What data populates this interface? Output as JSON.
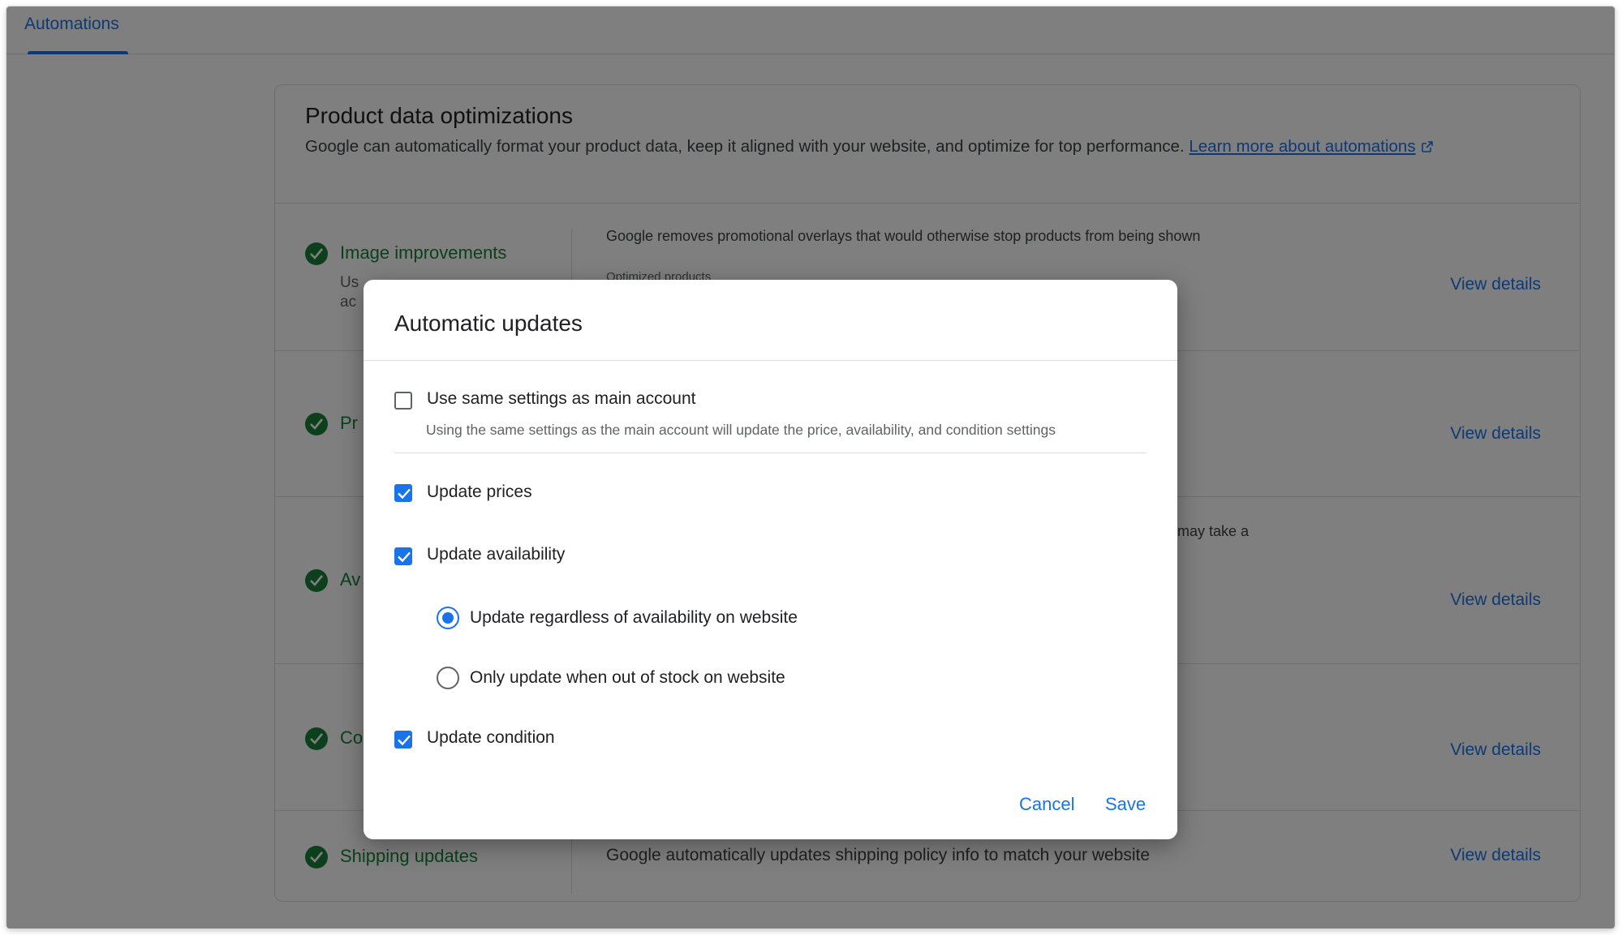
{
  "tabs": [
    {
      "label": "Automations",
      "active": true
    }
  ],
  "card": {
    "title": "Product data optimizations",
    "description": "Google can automatically format your product data, keep it aligned with your website, and optimize for top performance.",
    "learn_more_label": "Learn more about automations"
  },
  "automations": [
    {
      "title": "Image improvements",
      "subtitle_visible": "Us\nac",
      "description": "Google removes promotional overlays that would otherwise stop products from being shown",
      "secondary": "Optimized products",
      "link": "View details"
    },
    {
      "title": "Pr",
      "description": "",
      "link": "View details"
    },
    {
      "title": "Av",
      "description": "may take a",
      "link": "View details"
    },
    {
      "title": "Co",
      "description": "",
      "link": "View details"
    },
    {
      "title": "Shipping updates",
      "description": "Google automatically updates shipping policy info to match your website",
      "link": "View details"
    }
  ],
  "dialog": {
    "title": "Automatic updates",
    "same_settings": {
      "label": "Use same settings as main account",
      "help": "Using the same settings as the main account will update the price, availability, and condition settings",
      "checked": false
    },
    "update_prices": {
      "label": "Update prices",
      "checked": true
    },
    "update_availability": {
      "label": "Update availability",
      "checked": true
    },
    "availability_options": [
      {
        "label": "Update regardless of availability on website",
        "selected": true
      },
      {
        "label": "Only update when out of stock on website",
        "selected": false
      }
    ],
    "update_condition": {
      "label": "Update condition",
      "checked": true
    },
    "cancel_label": "Cancel",
    "save_label": "Save"
  },
  "colors": {
    "accent": "#1a73e8",
    "success": "#188038",
    "scrim": "rgba(0,0,0,0.5)"
  }
}
